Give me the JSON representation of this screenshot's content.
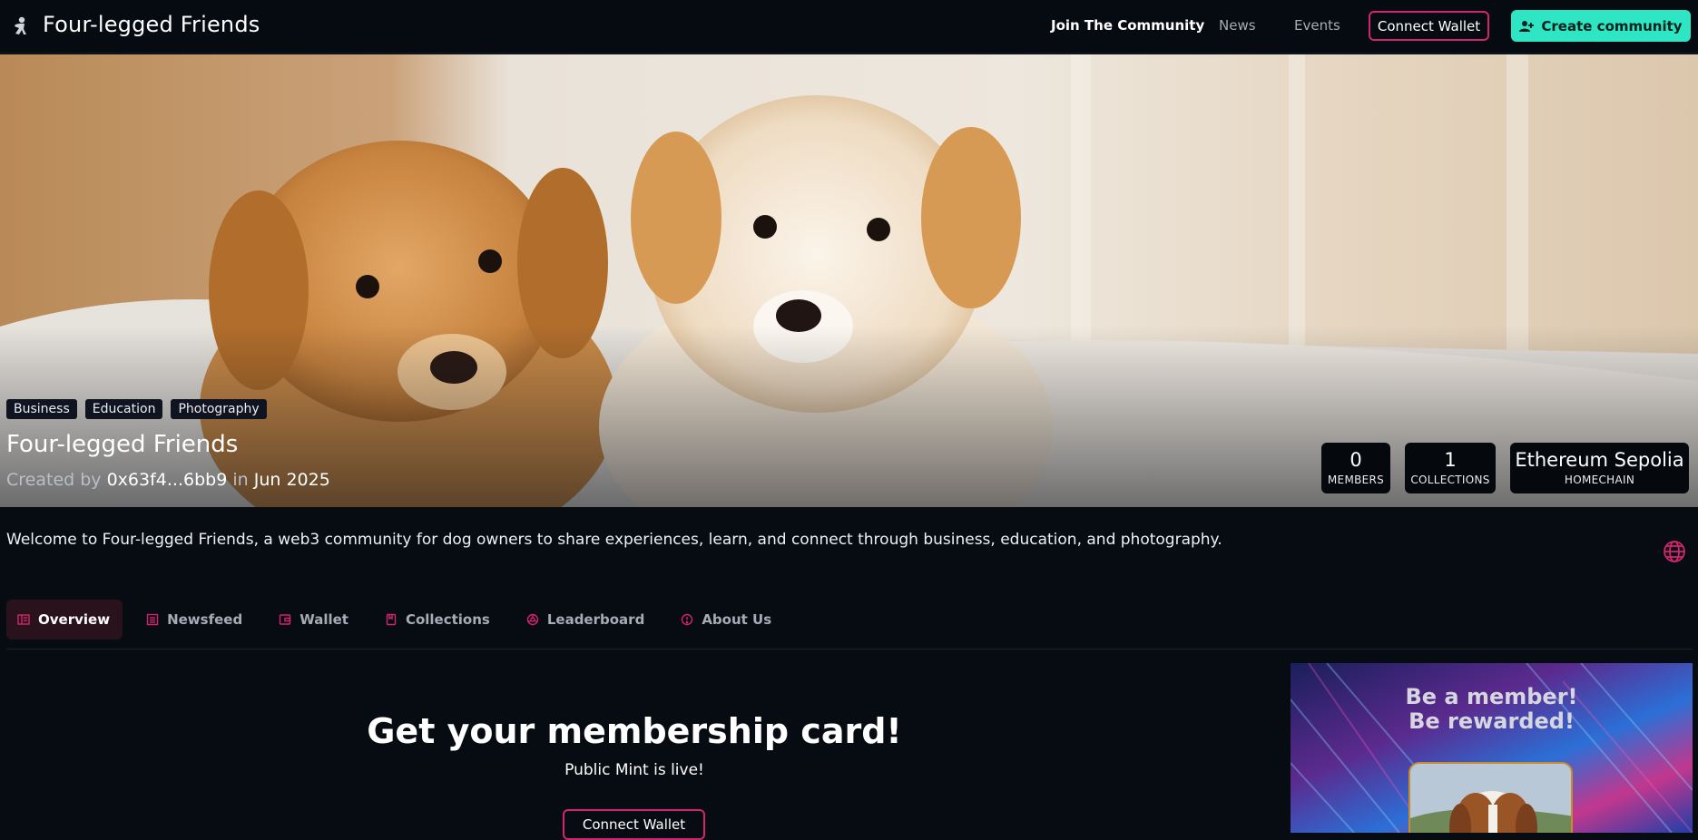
{
  "header": {
    "brand": "Four-legged Friends",
    "nav": {
      "join": "Join The Community",
      "news": "News",
      "events": "Events"
    },
    "connect_label": "Connect Wallet",
    "create_label": "Create community"
  },
  "hero": {
    "tags": [
      "Business",
      "Education",
      "Photography"
    ],
    "title": "Four-legged Friends",
    "created_by_prefix": "Created by",
    "creator": "0x63f4...6bb9",
    "in_word": "in",
    "date": "Jun 2025",
    "stats": [
      {
        "value": "0",
        "label": "MEMBERS"
      },
      {
        "value": "1",
        "label": "COLLECTIONS"
      },
      {
        "value": "Ethereum Sepolia",
        "label": "HOMECHAIN"
      }
    ]
  },
  "description": "Welcome to Four-legged Friends, a web3 community for dog owners to share experiences, learn, and connect through business, education, and photography.",
  "tabs": [
    {
      "label": "Overview",
      "icon": "overview-icon",
      "active": true
    },
    {
      "label": "Newsfeed",
      "icon": "newsfeed-icon"
    },
    {
      "label": "Wallet",
      "icon": "wallet-icon"
    },
    {
      "label": "Collections",
      "icon": "collections-icon"
    },
    {
      "label": "Leaderboard",
      "icon": "leaderboard-icon"
    },
    {
      "label": "About Us",
      "icon": "info-icon"
    }
  ],
  "membership": {
    "title": "Get your membership card!",
    "subtitle": "Public Mint is live!",
    "connect_label": "Connect Wallet"
  },
  "promo": {
    "line1": "Be a member!",
    "line2": "Be rewarded!"
  },
  "colors": {
    "accent_pink": "#d4246f",
    "accent_teal": "#2ee6c4",
    "background": "#070b12"
  }
}
